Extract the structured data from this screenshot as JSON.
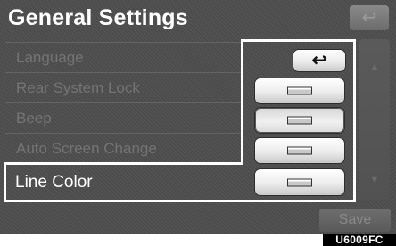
{
  "header": {
    "title": "General Settings",
    "back_icon": "return-arrow-icon"
  },
  "menu": {
    "items": [
      {
        "label": "Language",
        "state": "disabled"
      },
      {
        "label": "Rear System Lock",
        "state": "disabled"
      },
      {
        "label": "Beep",
        "state": "disabled"
      },
      {
        "label": "Auto Screen Change",
        "state": "disabled"
      }
    ],
    "selected": {
      "label": "Line Color"
    }
  },
  "panel": {
    "back_icon": "return-arrow-icon",
    "option_buttons": [
      {
        "name": "line-color-option",
        "icon": "color-swatch-icon"
      },
      {
        "name": "line-color-option",
        "icon": "color-swatch-icon",
        "pressed": true
      },
      {
        "name": "line-color-option",
        "icon": "color-swatch-icon"
      },
      {
        "name": "line-color-option",
        "icon": "color-swatch-icon"
      }
    ]
  },
  "scroll": {
    "up_icon": "scroll-up-icon",
    "down_icon": "scroll-down-icon"
  },
  "footer": {
    "save_label": "Save"
  },
  "figure_code": "U6009FC",
  "colors": {
    "screen_bg": "#4c4c4c",
    "highlight": "#ffffff",
    "disabled_text": "#747474"
  }
}
